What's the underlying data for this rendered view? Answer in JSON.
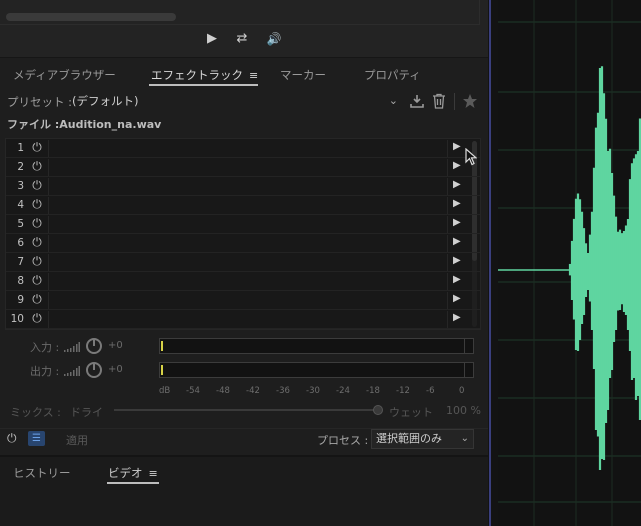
{
  "transport": {
    "play": "▶",
    "loop": "⇄",
    "volume": "🔊"
  },
  "tabs": [
    {
      "label": "メディアブラウザー"
    },
    {
      "label": "エフェクトラック",
      "menu": "≡"
    },
    {
      "label": "マーカー"
    },
    {
      "label": "プロパティ"
    }
  ],
  "preset": {
    "label": "プリセット :",
    "value": "(デフォルト)",
    "chevron": "⌄"
  },
  "file": {
    "label": "ファイル :Audition_na.wav"
  },
  "rack": {
    "rows": [
      "1",
      "2",
      "3",
      "4",
      "5",
      "6",
      "7",
      "8",
      "9",
      "10"
    ],
    "power_icon": "⏻",
    "arrow_icon": "▶"
  },
  "io": {
    "input_label": "入力 :",
    "output_label": "出力 :",
    "input_value": "+0",
    "output_value": "+0"
  },
  "scale": {
    "labels": [
      "dB",
      "-54",
      "-48",
      "-42",
      "-36",
      "-30",
      "-24",
      "-18",
      "-12",
      "-6",
      "0"
    ]
  },
  "mix": {
    "label": "ミックス :",
    "dry": "ドライ",
    "wet": "ウェット",
    "percent": "100 %",
    "level": 1.0
  },
  "controls": {
    "apply": "適用",
    "process_label": "プロセス :",
    "process_value": "選択範囲のみ"
  },
  "bottom_tabs": [
    {
      "label": "ヒストリー"
    },
    {
      "label": "ビデオ",
      "menu": "≡"
    }
  ],
  "colors": {
    "waveform": "#5fd5a0",
    "meter_tick": "#d7d247",
    "accent_blue": "#28456f"
  }
}
